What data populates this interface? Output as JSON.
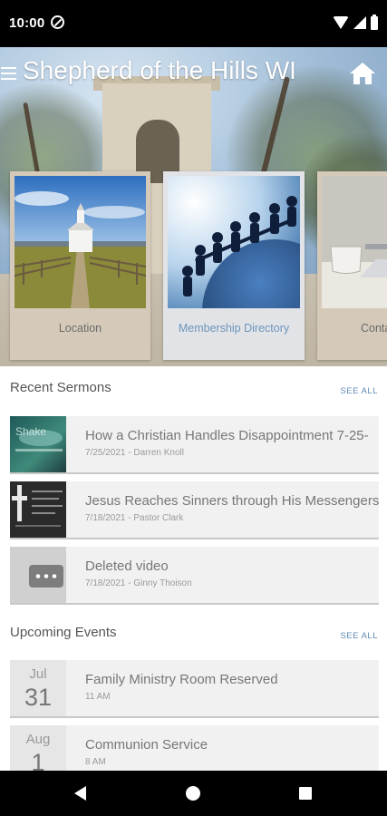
{
  "status_bar": {
    "time": "10:00"
  },
  "header": {
    "title": "Shepherd of the Hills WI"
  },
  "tiles": [
    {
      "label": "Location"
    },
    {
      "label": "Membership Directory"
    },
    {
      "label": "Conta"
    }
  ],
  "sermons": {
    "heading": "Recent Sermons",
    "see_all": "SEE ALL",
    "items": [
      {
        "title": "How a Christian Handles Disappointment 7-25-",
        "subtitle": "7/25/2021 - Darren Knoll",
        "thumb_text": "Shake"
      },
      {
        "title": "Jesus Reaches Sinners through His Messengers",
        "subtitle": "7/18/2021 - Pastor Clark"
      },
      {
        "title": "Deleted video",
        "subtitle": "7/18/2021 - Ginny Thoison"
      }
    ]
  },
  "events": {
    "heading": "Upcoming Events",
    "see_all": "SEE ALL",
    "items": [
      {
        "month": "Jul",
        "day": "31",
        "title": "Family Ministry Room Reserved",
        "time": "11 AM"
      },
      {
        "month": "Aug",
        "day": "1",
        "title": "Communion Service",
        "time": "8 AM"
      }
    ]
  }
}
